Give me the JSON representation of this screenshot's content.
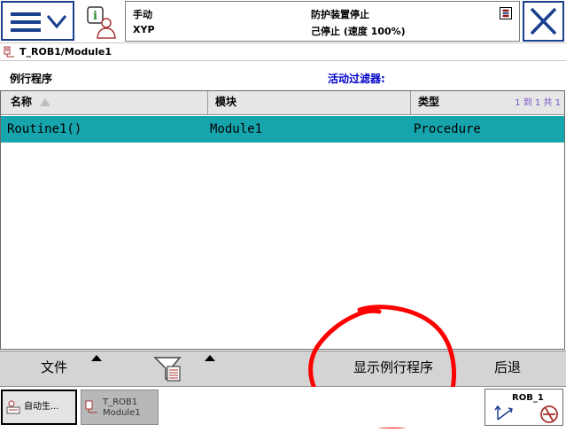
{
  "header": {
    "mode": "手动",
    "device": "XYP",
    "status_line1": "防护装置停止",
    "status_line2": "己停止 (速度 100%)"
  },
  "path": {
    "text": "T_ROB1/Module1"
  },
  "routines_view": {
    "title": "例行程序",
    "filter_label": "活动过滤器:",
    "columns": [
      "名称",
      "模块",
      "类型"
    ],
    "count_text": "1 到 1 共 1",
    "rows": [
      {
        "name": "Routine1()",
        "module": "Module1",
        "type": "Procedure"
      }
    ]
  },
  "commands": {
    "file": "文件",
    "show_routine": "显示例行程序",
    "back": "后退"
  },
  "taskbar": {
    "task1_label": "自动生...",
    "task2_line1": "T_ROB1",
    "task2_line2": "Module1",
    "robot_label": "ROB_1"
  },
  "colors": {
    "accent_blue": "#1a3f8e",
    "selected_row": "#17a5ad",
    "filter_text": "#0000cc",
    "annotation_red": "#ff0000"
  },
  "icons": [
    "hamburger-icon",
    "chevron-down-icon",
    "info-person-icon",
    "status-icon",
    "close-icon",
    "program-path-icon",
    "sort-asc-icon",
    "filter-icon",
    "auto-produce-icon",
    "program-editor-icon",
    "jog-axes-icon",
    "increment-off-icon"
  ]
}
